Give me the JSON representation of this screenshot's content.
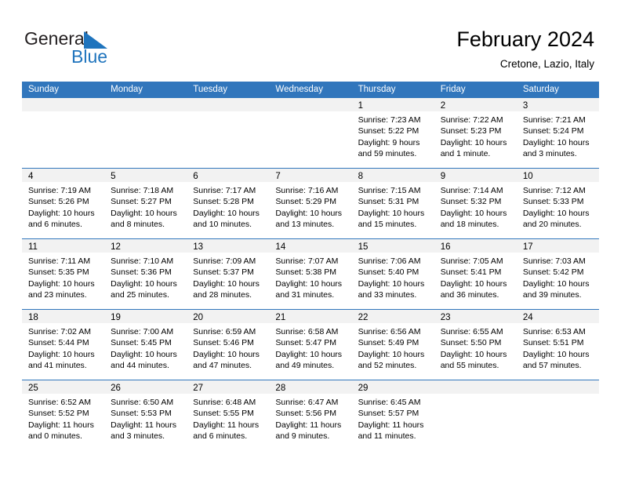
{
  "brand": {
    "name_part1": "General",
    "name_part2": "Blue",
    "mark_color": "#1f74bd"
  },
  "header": {
    "month_title": "February 2024",
    "location": "Cretone, Lazio, Italy",
    "header_bg_color": "#3176bc",
    "band_color": "#f2f2f2"
  },
  "weekdays": [
    "Sunday",
    "Monday",
    "Tuesday",
    "Wednesday",
    "Thursday",
    "Friday",
    "Saturday"
  ],
  "weeks": [
    [
      {
        "day": "",
        "lines": []
      },
      {
        "day": "",
        "lines": []
      },
      {
        "day": "",
        "lines": []
      },
      {
        "day": "",
        "lines": []
      },
      {
        "day": "1",
        "lines": [
          "Sunrise: 7:23 AM",
          "Sunset: 5:22 PM",
          "Daylight: 9 hours",
          "and 59 minutes."
        ]
      },
      {
        "day": "2",
        "lines": [
          "Sunrise: 7:22 AM",
          "Sunset: 5:23 PM",
          "Daylight: 10 hours",
          "and 1 minute."
        ]
      },
      {
        "day": "3",
        "lines": [
          "Sunrise: 7:21 AM",
          "Sunset: 5:24 PM",
          "Daylight: 10 hours",
          "and 3 minutes."
        ]
      }
    ],
    [
      {
        "day": "4",
        "lines": [
          "Sunrise: 7:19 AM",
          "Sunset: 5:26 PM",
          "Daylight: 10 hours",
          "and 6 minutes."
        ]
      },
      {
        "day": "5",
        "lines": [
          "Sunrise: 7:18 AM",
          "Sunset: 5:27 PM",
          "Daylight: 10 hours",
          "and 8 minutes."
        ]
      },
      {
        "day": "6",
        "lines": [
          "Sunrise: 7:17 AM",
          "Sunset: 5:28 PM",
          "Daylight: 10 hours",
          "and 10 minutes."
        ]
      },
      {
        "day": "7",
        "lines": [
          "Sunrise: 7:16 AM",
          "Sunset: 5:29 PM",
          "Daylight: 10 hours",
          "and 13 minutes."
        ]
      },
      {
        "day": "8",
        "lines": [
          "Sunrise: 7:15 AM",
          "Sunset: 5:31 PM",
          "Daylight: 10 hours",
          "and 15 minutes."
        ]
      },
      {
        "day": "9",
        "lines": [
          "Sunrise: 7:14 AM",
          "Sunset: 5:32 PM",
          "Daylight: 10 hours",
          "and 18 minutes."
        ]
      },
      {
        "day": "10",
        "lines": [
          "Sunrise: 7:12 AM",
          "Sunset: 5:33 PM",
          "Daylight: 10 hours",
          "and 20 minutes."
        ]
      }
    ],
    [
      {
        "day": "11",
        "lines": [
          "Sunrise: 7:11 AM",
          "Sunset: 5:35 PM",
          "Daylight: 10 hours",
          "and 23 minutes."
        ]
      },
      {
        "day": "12",
        "lines": [
          "Sunrise: 7:10 AM",
          "Sunset: 5:36 PM",
          "Daylight: 10 hours",
          "and 25 minutes."
        ]
      },
      {
        "day": "13",
        "lines": [
          "Sunrise: 7:09 AM",
          "Sunset: 5:37 PM",
          "Daylight: 10 hours",
          "and 28 minutes."
        ]
      },
      {
        "day": "14",
        "lines": [
          "Sunrise: 7:07 AM",
          "Sunset: 5:38 PM",
          "Daylight: 10 hours",
          "and 31 minutes."
        ]
      },
      {
        "day": "15",
        "lines": [
          "Sunrise: 7:06 AM",
          "Sunset: 5:40 PM",
          "Daylight: 10 hours",
          "and 33 minutes."
        ]
      },
      {
        "day": "16",
        "lines": [
          "Sunrise: 7:05 AM",
          "Sunset: 5:41 PM",
          "Daylight: 10 hours",
          "and 36 minutes."
        ]
      },
      {
        "day": "17",
        "lines": [
          "Sunrise: 7:03 AM",
          "Sunset: 5:42 PM",
          "Daylight: 10 hours",
          "and 39 minutes."
        ]
      }
    ],
    [
      {
        "day": "18",
        "lines": [
          "Sunrise: 7:02 AM",
          "Sunset: 5:44 PM",
          "Daylight: 10 hours",
          "and 41 minutes."
        ]
      },
      {
        "day": "19",
        "lines": [
          "Sunrise: 7:00 AM",
          "Sunset: 5:45 PM",
          "Daylight: 10 hours",
          "and 44 minutes."
        ]
      },
      {
        "day": "20",
        "lines": [
          "Sunrise: 6:59 AM",
          "Sunset: 5:46 PM",
          "Daylight: 10 hours",
          "and 47 minutes."
        ]
      },
      {
        "day": "21",
        "lines": [
          "Sunrise: 6:58 AM",
          "Sunset: 5:47 PM",
          "Daylight: 10 hours",
          "and 49 minutes."
        ]
      },
      {
        "day": "22",
        "lines": [
          "Sunrise: 6:56 AM",
          "Sunset: 5:49 PM",
          "Daylight: 10 hours",
          "and 52 minutes."
        ]
      },
      {
        "day": "23",
        "lines": [
          "Sunrise: 6:55 AM",
          "Sunset: 5:50 PM",
          "Daylight: 10 hours",
          "and 55 minutes."
        ]
      },
      {
        "day": "24",
        "lines": [
          "Sunrise: 6:53 AM",
          "Sunset: 5:51 PM",
          "Daylight: 10 hours",
          "and 57 minutes."
        ]
      }
    ],
    [
      {
        "day": "25",
        "lines": [
          "Sunrise: 6:52 AM",
          "Sunset: 5:52 PM",
          "Daylight: 11 hours",
          "and 0 minutes."
        ]
      },
      {
        "day": "26",
        "lines": [
          "Sunrise: 6:50 AM",
          "Sunset: 5:53 PM",
          "Daylight: 11 hours",
          "and 3 minutes."
        ]
      },
      {
        "day": "27",
        "lines": [
          "Sunrise: 6:48 AM",
          "Sunset: 5:55 PM",
          "Daylight: 11 hours",
          "and 6 minutes."
        ]
      },
      {
        "day": "28",
        "lines": [
          "Sunrise: 6:47 AM",
          "Sunset: 5:56 PM",
          "Daylight: 11 hours",
          "and 9 minutes."
        ]
      },
      {
        "day": "29",
        "lines": [
          "Sunrise: 6:45 AM",
          "Sunset: 5:57 PM",
          "Daylight: 11 hours",
          "and 11 minutes."
        ]
      },
      {
        "day": "",
        "lines": []
      },
      {
        "day": "",
        "lines": []
      }
    ]
  ]
}
